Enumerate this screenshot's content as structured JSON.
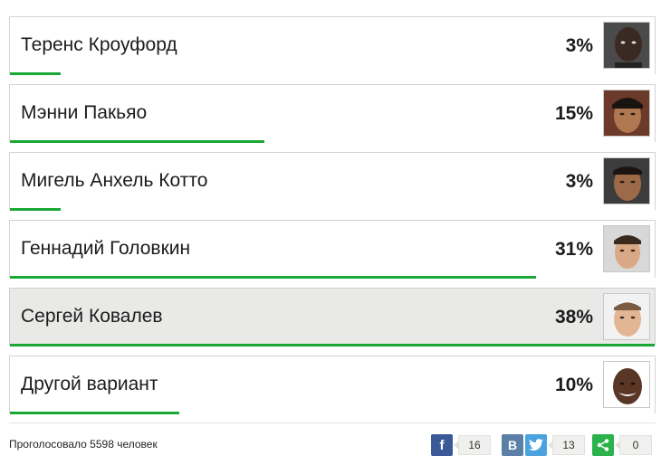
{
  "poll": {
    "options": [
      {
        "name": "Теренс Кроуфорд",
        "percent_label": "3%",
        "percent": 3,
        "selected": false
      },
      {
        "name": "Мэнни Пакьяо",
        "percent_label": "15%",
        "percent": 15,
        "selected": false
      },
      {
        "name": "Мигель Анхель Котто",
        "percent_label": "3%",
        "percent": 3,
        "selected": false
      },
      {
        "name": "Геннадий Головкин",
        "percent_label": "31%",
        "percent": 31,
        "selected": false
      },
      {
        "name": "Сергей Ковалев",
        "percent_label": "38%",
        "percent": 38,
        "selected": true
      },
      {
        "name": "Другой вариант",
        "percent_label": "10%",
        "percent": 10,
        "selected": false
      }
    ],
    "bar_color": "#19a735"
  },
  "footer": {
    "voted_text": "Проголосовало 5598 человек",
    "share": {
      "facebook": {
        "icon": "facebook-icon",
        "letter": "f",
        "count": "16",
        "color": "#3b5998"
      },
      "vkontakte": {
        "icon": "vk-icon",
        "letter": "В",
        "color": "#5b7fa6"
      },
      "twitter": {
        "icon": "twitter-icon",
        "count": "13",
        "color": "#4aa3df"
      },
      "generic": {
        "icon": "share-icon",
        "count": "0",
        "color": "#2bb24c"
      }
    }
  }
}
